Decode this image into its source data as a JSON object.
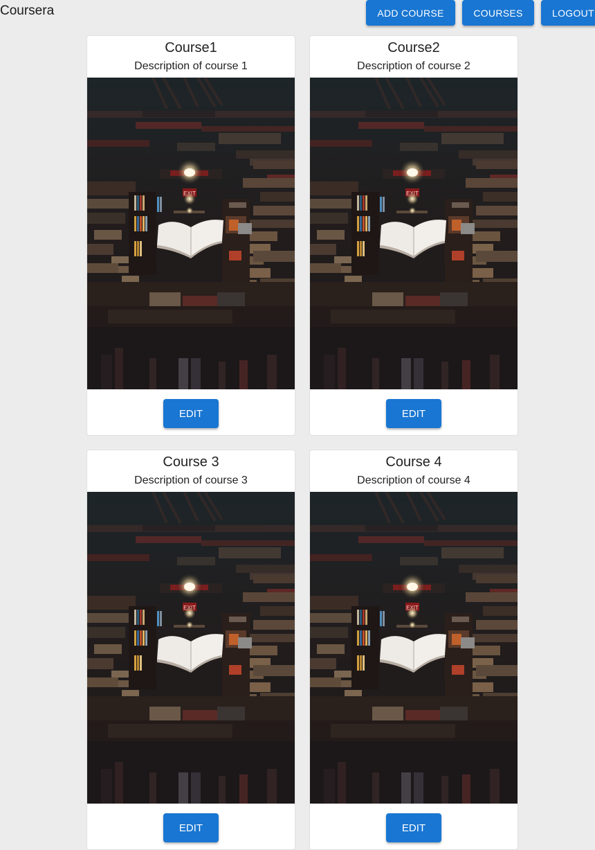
{
  "header": {
    "brand": "Coursera",
    "buttons": {
      "add_course": "ADD COURSE",
      "courses": "COURSES",
      "logout": "LOGOUT"
    }
  },
  "colors": {
    "primary": "#1976d2",
    "background": "#ececec",
    "card": "#ffffff"
  },
  "courses": [
    {
      "title": "Course1",
      "description": "Description of course 1",
      "image": "library-floating-book-photo",
      "action": "EDIT"
    },
    {
      "title": "Course2",
      "description": "Description of course 2",
      "image": "library-floating-book-photo",
      "action": "EDIT"
    },
    {
      "title": "Course 3",
      "description": "Description of course 3",
      "image": "library-floating-book-photo",
      "action": "EDIT"
    },
    {
      "title": "Course 4",
      "description": "Description of course 4",
      "image": "library-floating-book-photo",
      "action": "EDIT"
    }
  ],
  "image_text": {
    "exit_sign": "EXIT"
  }
}
